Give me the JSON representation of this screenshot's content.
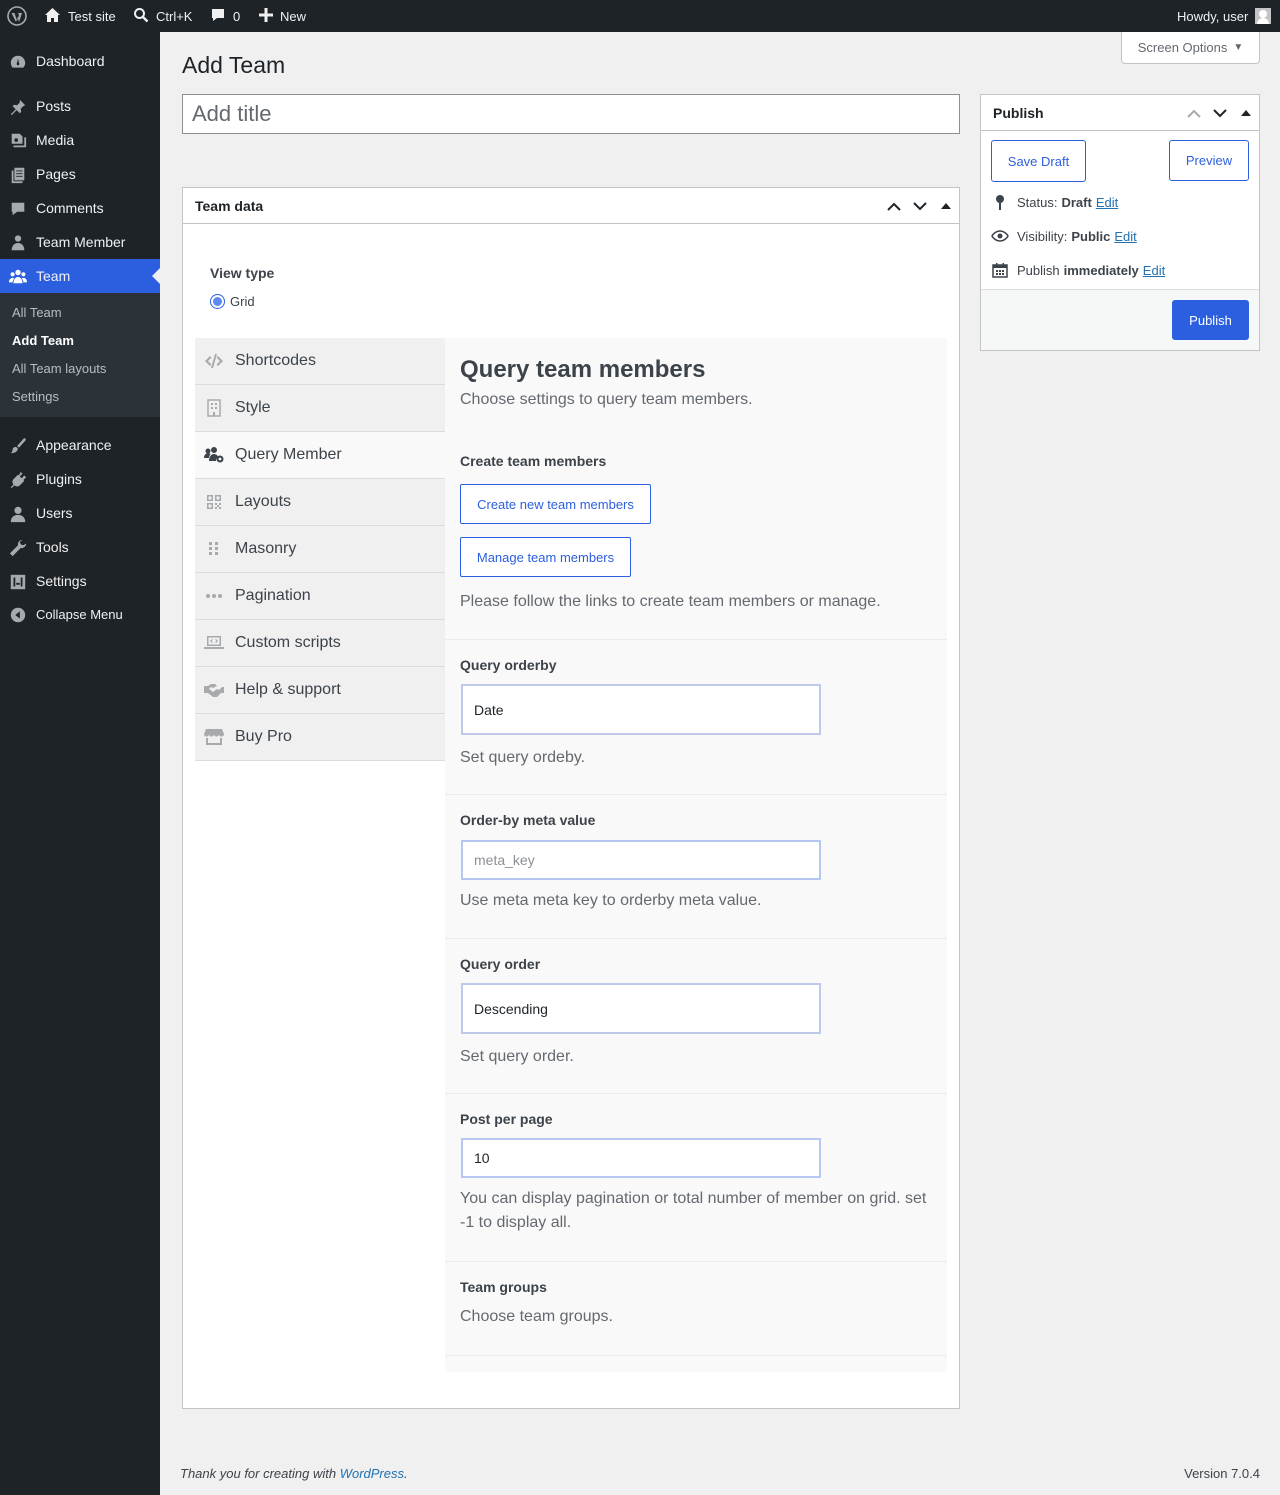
{
  "admin_bar": {
    "site_name": "Test site",
    "search_shortcut": "Ctrl+K",
    "comments_count": "0",
    "new_label": "New",
    "greeting": "Howdy, user"
  },
  "sidebar": {
    "items": [
      {
        "label": "Dashboard",
        "icon": "dashboard-icon"
      },
      {
        "label": "Posts",
        "icon": "pin-icon"
      },
      {
        "label": "Media",
        "icon": "media-icon"
      },
      {
        "label": "Pages",
        "icon": "pages-icon"
      },
      {
        "label": "Comments",
        "icon": "comment-icon"
      },
      {
        "label": "Team Member",
        "icon": "person-icon"
      },
      {
        "label": "Team",
        "icon": "team-icon"
      },
      {
        "label": "Appearance",
        "icon": "brush-icon"
      },
      {
        "label": "Plugins",
        "icon": "plugin-icon"
      },
      {
        "label": "Users",
        "icon": "users-icon"
      },
      {
        "label": "Tools",
        "icon": "wrench-icon"
      },
      {
        "label": "Settings",
        "icon": "settings-icon"
      },
      {
        "label": "Collapse Menu",
        "icon": "collapse-icon"
      }
    ],
    "submenu": [
      "All Team",
      "Add Team",
      "All Team layouts",
      "Settings"
    ]
  },
  "screen_options": "Screen Options",
  "page_title": "Add Team",
  "title_placeholder": "Add title",
  "team_box": {
    "title": "Team data",
    "view_type_label": "View type",
    "view_type_option": "Grid",
    "tabs": [
      "Shortcodes",
      "Style",
      "Query Member",
      "Layouts",
      "Masonry",
      "Pagination",
      "Custom scripts",
      "Help & support",
      "Buy Pro"
    ],
    "panel": {
      "heading": "Query team members",
      "subheading": "Choose settings to query team members.",
      "create_label": "Create team members",
      "create_button": "Create new team members",
      "manage_button": "Manage team members",
      "create_desc": "Please follow the links to create team members or manage.",
      "orderby_label": "Query orderby",
      "orderby_value": "Date",
      "orderby_desc": "Set query ordeby.",
      "meta_label": "Order-by meta value",
      "meta_placeholder": "meta_key",
      "meta_desc": "Use meta meta key to orderby meta value.",
      "order_label": "Query order",
      "order_value": "Descending",
      "order_desc": "Set query order.",
      "ppp_label": "Post per page",
      "ppp_value": "10",
      "ppp_desc": "You can display pagination or total number of member on grid. set -1 to display all.",
      "groups_label": "Team groups",
      "groups_desc": "Choose team groups."
    }
  },
  "publish": {
    "title": "Publish",
    "save_draft": "Save Draft",
    "preview": "Preview",
    "status_label": "Status:",
    "status_value": "Draft",
    "visibility_label": "Visibility:",
    "visibility_value": "Public",
    "publish_label": "Publish",
    "publish_value": "immediately",
    "edit": "Edit",
    "publish_button": "Publish"
  },
  "footer": {
    "thanks_prefix": "Thank you for creating with",
    "thanks_link": "WordPress",
    "version": "Version 7.0.4"
  },
  "colors": {
    "accent": "#2c5fe0",
    "admin_bg": "#1d2327"
  }
}
